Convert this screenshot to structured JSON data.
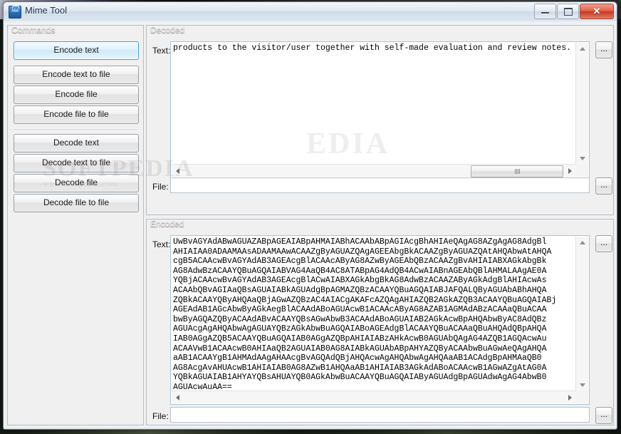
{
  "window": {
    "title": "Mime Tool",
    "icon": "mime-tool-icon",
    "controls": {
      "minimize": "–",
      "maximize": "□",
      "close": "✕"
    }
  },
  "watermark": {
    "top": "SOFTPEDIA",
    "mid_big": "SOFTPEDIA",
    "mid_small": "www.softpedia.com",
    "mid_ghost": "EDIA"
  },
  "commands": {
    "legend": "Commands",
    "buttons": [
      {
        "label": "Encode text",
        "focused": true
      },
      {
        "label": "Encode text to file",
        "focused": false
      },
      {
        "label": "Encode file",
        "focused": false
      },
      {
        "label": "Encode file to file",
        "focused": false
      },
      {
        "label": "Decode text",
        "focused": false
      },
      {
        "label": "Decode text to file",
        "focused": false
      },
      {
        "label": "Decode file",
        "focused": false
      },
      {
        "label": "Decode file to file",
        "focused": false
      }
    ]
  },
  "decoded": {
    "legend": "Decoded",
    "text_label": "Text:",
    "text_value": "products to the visitor/user together with self-made evaluation and review notes.",
    "text_browse": "...",
    "file_label": "File:",
    "file_value": "",
    "file_placeholder": "",
    "file_browse": "..."
  },
  "encoded": {
    "legend": "Encoded",
    "text_label": "Text:",
    "text_value": "UwBvAGYAdABwAGUAZABpAGEAIABpAHMAIABhACAAbABpAGIAcgBhAHIAeQAgAG8AZgAgAG8AdgBlAHIAIAA0ADAAMAAsADAAMAAwACAAZgByAGUAUAZQAgAGEEAbgBkACAAZgByAGUAUAZQAtAHQAbwAtAHQAcgB5ACAAcwBvAGYAdAB3AGEAcgB1ACAAcAByAG8AZwByAGEAbQBzACAAZgBvAHIAIABXAGkAbgBkAG8AdwBzACAAYQBuAGQAIABBVAG4AaQB4AC8ATABpAG4AdQB4AC8ATABpAG4AdQB4ACwAIABnAGEAbQBlAHMALAAgAEOAYQBjACAAcwBvAGYAdAB3AGEAcgBlACwAIABXAGkAbgBkAG8AdwBzACAAZAByAGkAdgBlAHIAcwAsACAAbQBvAGIAaQBsAGUAIABkAGUAdgBpAGMAZQBzACAAYQBuAGQAIABJAFQALQByAGUAbABhAHQAaAHQA",
    "text_lines": [
      "UwBvAGYAdABwAGUAZABpAGEAIABpAHMAIABhACAAbABpAGIAcgBhAHIAeQAgAG8AZgAgAG8AdgBl",
      "AHIAIAA0ADAAMAAsADAAMAAwACAAZgByAGUAZQAgAGEEAbgBkACAAZgByAGUAZQAtAHQAbwAtAHQA",
      "cgB5ACAAcwBvAGYAdAB3AGEAcgBlACAAcAByAG8AZwByAGEAbQBzACAAZgBvAHIAIABXAGkAbgBk",
      "AG8AdwBzACAAYQBuAGQAIABVAG4AaQB4AC8ATABpAG4AdQB4ACwAIABnAGEAbQBlAHMALAAgAE0A",
      "YQBjACAAcwBvAGYAdAB3AGEAcgBlACwAIABXAGkAbgBkAG8AdwBzACAAZAByAGkAdgBlAHIAcwAs",
      "ACAAbQBvAGIAaQBsAGUAIABkAGUAdgBpAGMAZQBzACAAYQBuAGQAIABJAFQALQByAGUAbABhAHQA",
      "ZQBkACAAYQByAHQAaQBjAGwAZQBzAC4AIACgAKAFcAZQAgAHIAZQB2AGkAZQB3ACAAYQBuAGQAIABj",
      "AGEAdAB1AGcAbwByAGkAegBlACAAdABoAGUAcwB1ACAAcAByAG8AZAB1AGMAdABzACAAaQBuACAA",
      "bwByAGQAZQByACAAdABvACAAYQBsAGwAbwB3ACAAdABoAGUAIAB2AGkAcwBpAHQAbwByAC8AdQBz",
      "AGUAcgAgAHQAbwAgAGUAYQBzAGkAbwBuAGQAIABoAGEAdgBlACAAYQBuACAAaQBuAHQAdQBpAHQA",
      "IAB0AGgAZQB5ACAAYQBuAGQAIAB0AGgAZQBpAHIAIABzAHkAcwB0AGUAbQAgAG4AZQB1AGQAcwAu",
      "ACAAVwB1ACAAcwB0AHIAaQB2AGUAIAB0AG8AIABkAGUAbABpAHYAZQByACAAbwBuAGwAeQAgAHQA",
      "aAB1ACAAYgB1AHMAdAAgAHAAcgBvAGQAdQBjAHQAcwAgAHQAbwAgAHQAaAB1ACAdgBpAHMAaQB0",
      "AG8AcgAvAHUAcwB1AHIAIAB0AG8AZwB1AHQAaAB1AHIAIAB3AGkAdABoACAAcwB1AGwAZgAtAG0A",
      "YQBkAGUAIAB1AHYAYQBsAHUAYQB0AGkAbwBuACAAYQBuAGQAIAByAGUAdgBpAGUAdwAgAG4AbwB0",
      "AGUAcwAuAA=="
    ],
    "text_browse": "...",
    "file_label": "File:",
    "file_value": "",
    "file_browse": "..."
  },
  "colors": {
    "focus_border": "#3c9fd6",
    "group_bg": "#f0f0f0",
    "close_button": "#c63a22",
    "textbox_border": "#a8c4d8"
  }
}
